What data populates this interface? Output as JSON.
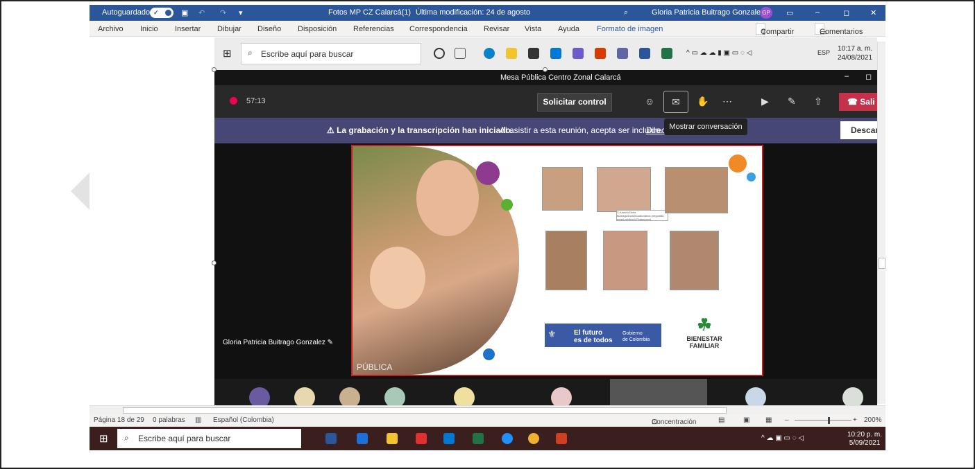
{
  "word": {
    "title_bar": {
      "autosave_label": "Autoguardado",
      "toggle_label": "✓",
      "doc_title": "Fotos MP CZ Calarcá(1)",
      "modified": "Última modificación: 24 de agosto",
      "user_name": "Gloria Patricia Buitrago Gonzalez",
      "user_initials": "GP"
    },
    "ribbon_tabs": [
      "Archivo",
      "Inicio",
      "Insertar",
      "Dibujar",
      "Diseño",
      "Disposición",
      "Referencias",
      "Correspondencia",
      "Revisar",
      "Vista",
      "Ayuda",
      "Formato de imagen"
    ],
    "share_label": "Compartir",
    "comments_label": "Comentarios",
    "status": {
      "page": "Página 18 de 29",
      "words": "0 palabras",
      "language": "Español (Colombia)",
      "focus": "Concentración",
      "zoom": "200%"
    }
  },
  "embedded_screenshot": {
    "taskbar": {
      "search_placeholder": "Escribe aquí para buscar",
      "lang": "ESP",
      "time": "10:17 a. m.",
      "date": "24/08/2021"
    },
    "teams": {
      "window_title": "Mesa Pública Centro Zonal Calarcá",
      "timer": "57:13",
      "request_control": "Solicitar control",
      "leave_label": "Sali",
      "banner_bold": "La grabación y la transcripción han iniciado.",
      "banner_text": "Al asistir a esta reunión, acepta ser incluido.",
      "banner_link": "Direc",
      "banner_button": "Descart",
      "tooltip": "Mostrar conversación",
      "presenter_name": "Gloria Patricia Buitrago Gonzalez",
      "slide_watermark": "PÚBLICA",
      "slide_logo_line1": "El futuro",
      "slide_logo_line2": "es de todos",
      "slide_logo_gov1": "Gobierno",
      "slide_logo_gov2": "de Colombia",
      "slide_icbf1": "BIENESTAR",
      "slide_icbf2": "FAMILIAR",
      "path_caption": "C:\\Users\\Gloria Buitrago\\Downloads\\videos preguntas mesa publica\\4 Pinitos.mp4"
    }
  },
  "host_taskbar": {
    "search_placeholder": "Escribe aquí para buscar",
    "time": "10:20 p. m.",
    "date": "5/09/2021"
  }
}
